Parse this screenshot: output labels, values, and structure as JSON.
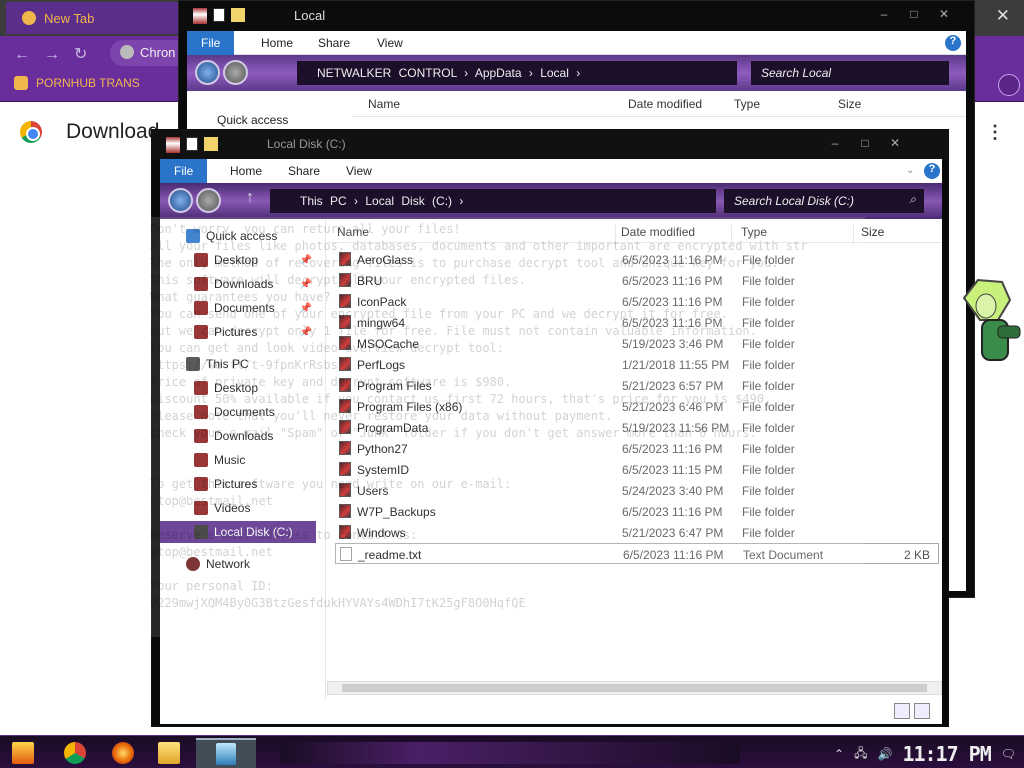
{
  "browser": {
    "tab_title": "New Tab",
    "omnibox_text": "Chron",
    "bookmark_label": "PORNHUB TRANS",
    "page_title": "Download",
    "close_glyph": "✕",
    "kebab_glyph": "⋮"
  },
  "back_window": {
    "title": "Local",
    "ribbon": {
      "file": "File",
      "home": "Home",
      "share": "Share",
      "view": "View"
    },
    "breadcrumb": [
      "NETWALKER CONTROL",
      "AppData",
      "Local"
    ],
    "search_placeholder": "Search Local",
    "nav_quick_access": "Quick access",
    "columns": {
      "name": "Name",
      "date": "Date modified",
      "type": "Type",
      "size": "Size"
    }
  },
  "front_window": {
    "title": "Local Disk (C:)",
    "ribbon": {
      "file": "File",
      "home": "Home",
      "share": "Share",
      "view": "View"
    },
    "breadcrumb": [
      "This PC",
      "Local Disk (C:)"
    ],
    "search_placeholder": "Search Local Disk (C:)",
    "nav": [
      {
        "label": "Quick access",
        "icon": "star-icon"
      },
      {
        "label": "Desktop",
        "icon": "folder-icon",
        "pinned": true
      },
      {
        "label": "Downloads",
        "icon": "folder-icon",
        "pinned": true
      },
      {
        "label": "Documents",
        "icon": "folder-icon",
        "pinned": true
      },
      {
        "label": "Pictures",
        "icon": "folder-icon",
        "pinned": true
      },
      {
        "label": "This PC",
        "icon": "computer-icon"
      },
      {
        "label": "Desktop",
        "icon": "folder-icon"
      },
      {
        "label": "Documents",
        "icon": "folder-icon"
      },
      {
        "label": "Downloads",
        "icon": "folder-icon"
      },
      {
        "label": "Music",
        "icon": "music-icon"
      },
      {
        "label": "Pictures",
        "icon": "folder-icon"
      },
      {
        "label": "Videos",
        "icon": "folder-icon"
      },
      {
        "label": "Local Disk (C:)",
        "icon": "disk-icon",
        "selected": true
      },
      {
        "label": "Network",
        "icon": "network-icon"
      }
    ],
    "columns": {
      "name": "Name",
      "date": "Date modified",
      "type": "Type",
      "size": "Size"
    },
    "files": [
      {
        "name": "AeroGlass",
        "date": "6/5/2023 11:16 PM",
        "type": "File folder",
        "size": ""
      },
      {
        "name": "BRU",
        "date": "6/5/2023 11:16 PM",
        "type": "File folder",
        "size": ""
      },
      {
        "name": "IconPack",
        "date": "6/5/2023 11:16 PM",
        "type": "File folder",
        "size": ""
      },
      {
        "name": "mingw64",
        "date": "6/5/2023 11:16 PM",
        "type": "File folder",
        "size": ""
      },
      {
        "name": "MSOCache",
        "date": "5/19/2023 3:46 PM",
        "type": "File folder",
        "size": ""
      },
      {
        "name": "PerfLogs",
        "date": "1/21/2018 11:55 PM",
        "type": "File folder",
        "size": ""
      },
      {
        "name": "Program Files",
        "date": "5/21/2023 6:57 PM",
        "type": "File folder",
        "size": ""
      },
      {
        "name": "Program Files (x86)",
        "date": "5/21/2023 6:46 PM",
        "type": "File folder",
        "size": ""
      },
      {
        "name": "ProgramData",
        "date": "5/19/2023 11:56 PM",
        "type": "File folder",
        "size": ""
      },
      {
        "name": "Python27",
        "date": "6/5/2023 11:16 PM",
        "type": "File folder",
        "size": ""
      },
      {
        "name": "SystemID",
        "date": "6/5/2023 11:15 PM",
        "type": "File folder",
        "size": ""
      },
      {
        "name": "Users",
        "date": "5/24/2023 3:40 PM",
        "type": "File folder",
        "size": ""
      },
      {
        "name": "W7P_Backups",
        "date": "6/5/2023 11:16 PM",
        "type": "File folder",
        "size": ""
      },
      {
        "name": "Windows",
        "date": "5/21/2023 6:47 PM",
        "type": "File folder",
        "size": ""
      },
      {
        "name": "_readme.txt",
        "date": "6/5/2023 11:16 PM",
        "type": "Text Document",
        "size": "2 KB"
      }
    ]
  },
  "ghost_note": "Don't worry, you can return all your files!\nAll your files like photos, databases, documents and other important are encrypted with str\nThe only method of recovering files is to purchase decrypt tool and unique key for you.\nThis software will decrypt all your encrypted files.\nWhat guarantees you have?\nYou can send one of your encrypted file from your PC and we decrypt it for free.\nBut we can decrypt only 1 file for free. File must not contain valuable information.\nYou can get and look video overview decrypt tool:\nhttps://we.tl/t-9fpnKrRsbs\nPrice of private key and decrypt software is $980.\nDiscount 50% available if you contact us first 72 hours, that's price for you is $490.\nPlease note that you'll never restore your data without payment.\nCheck your e-mail \"Spam\" or \"Junk\" folder if you don't get answer more than 6 hours.\n\n\nTo get this software you need write on our e-mail:\nstop@bestmail.net\n\nReserve e-mail address to contact us:\nstop@bestmail.net\n\nYour personal ID:\n0229mwjXQM4By0G3BtzGesfdukHYVAYs4WDhI7tK25gF8O0HqfQE",
  "taskbar": {
    "clock": "11:17 PM"
  },
  "colors": {
    "accent": "#5b2e8b",
    "ribbon_file": "#2a74c9",
    "bookmark_text": "#f0b64c"
  }
}
